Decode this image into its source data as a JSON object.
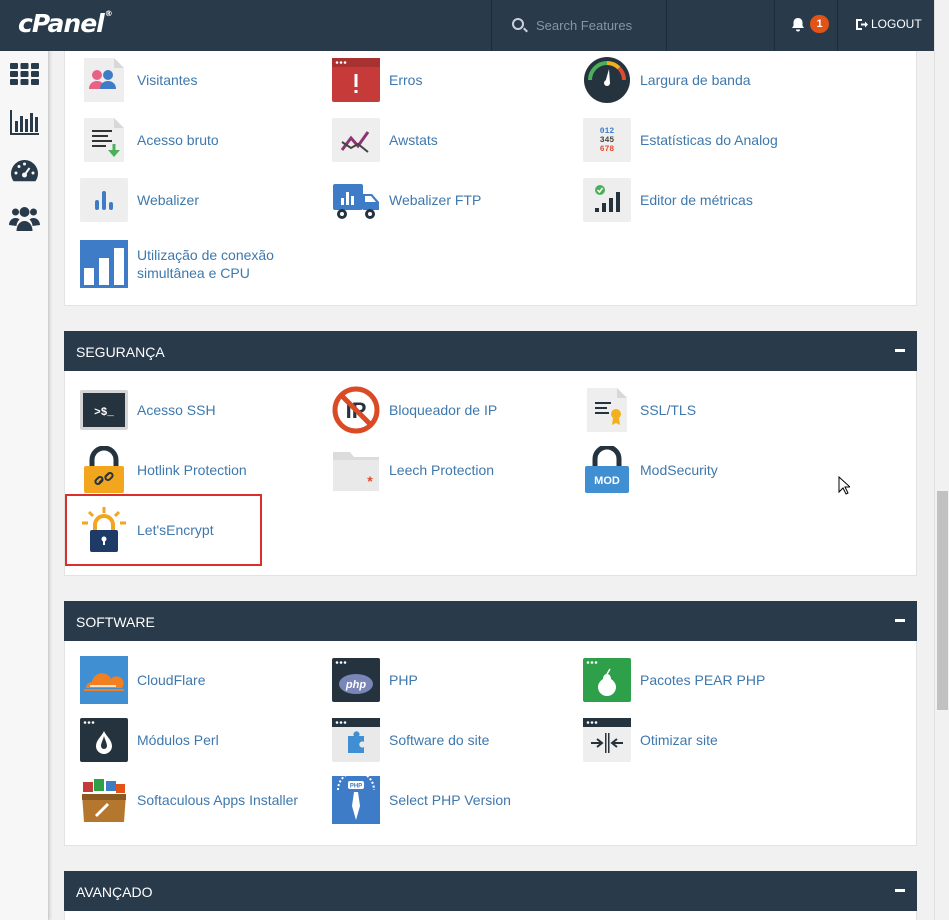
{
  "topbar": {
    "logo": "cPanel",
    "search_placeholder": "Search Features",
    "notification_count": "1",
    "logout_label": "LOGOUT"
  },
  "sidebar": {
    "items": [
      "grid-icon",
      "stats-icon",
      "dashboard-icon",
      "users-icon"
    ]
  },
  "sections": {
    "metrics": {
      "items": [
        {
          "label": "Visitantes"
        },
        {
          "label": "Erros"
        },
        {
          "label": "Largura de banda"
        },
        {
          "label": "Acesso bruto"
        },
        {
          "label": "Awstats"
        },
        {
          "label": "Estatísticas do Analog"
        },
        {
          "label": "Webalizer"
        },
        {
          "label": "Webalizer FTP"
        },
        {
          "label": "Editor de métricas"
        },
        {
          "label": "Utilização de conexão simultânea e CPU"
        }
      ]
    },
    "security": {
      "title": "SEGURANÇA",
      "items": [
        {
          "label": "Acesso SSH"
        },
        {
          "label": "Bloqueador de IP"
        },
        {
          "label": "SSL/TLS"
        },
        {
          "label": "Hotlink Protection"
        },
        {
          "label": "Leech Protection"
        },
        {
          "label": "ModSecurity"
        },
        {
          "label": "Let'sEncrypt"
        }
      ]
    },
    "software": {
      "title": "SOFTWARE",
      "items": [
        {
          "label": "CloudFlare"
        },
        {
          "label": "PHP"
        },
        {
          "label": "Pacotes PEAR PHP"
        },
        {
          "label": "Módulos Perl"
        },
        {
          "label": "Software do site"
        },
        {
          "label": "Otimizar site"
        },
        {
          "label": "Softaculous Apps Installer"
        },
        {
          "label": "Select PHP Version"
        }
      ]
    },
    "advanced": {
      "title": "AVANÇADO"
    }
  },
  "icon_text": {
    "ssh": ">$_",
    "mod": "MOD",
    "php": "php",
    "php_badge": "PHP",
    "analog_rows": [
      "012",
      "345",
      "678"
    ]
  },
  "colors": {
    "topbar": "#293a4a",
    "link": "#3e78ad",
    "badge": "#e25317",
    "highlight": "#d9302d"
  }
}
